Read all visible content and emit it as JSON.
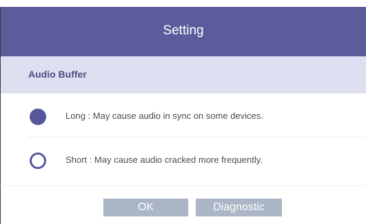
{
  "dialog": {
    "title": "Setting"
  },
  "section": {
    "title": "Audio Buffer"
  },
  "options": [
    {
      "label": "Long : May cause audio in sync on some devices.",
      "selected": true
    },
    {
      "label": "Short : May cause audio cracked more frequently.",
      "selected": false
    }
  ],
  "buttons": {
    "ok_label": "OK",
    "diagnostic_label": "Diagnostic"
  },
  "colors": {
    "title_bar": "#5a5c9c",
    "section_header": "#dedff0",
    "radio_accent": "#55579a",
    "button_bg": "#aab5c6"
  }
}
